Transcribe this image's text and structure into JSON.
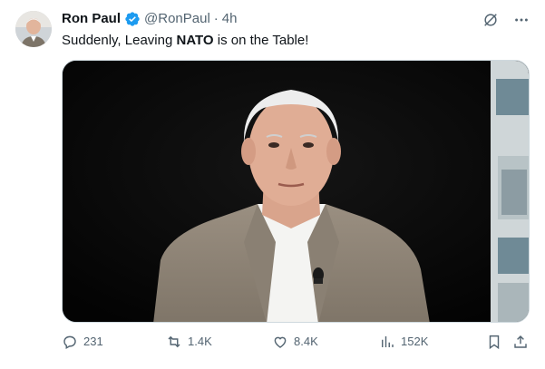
{
  "tweet": {
    "author_name": "Ron Paul",
    "handle": "@RonPaul",
    "separator": "·",
    "time": "4h",
    "text_prefix": "Suddenly, Leaving ",
    "text_bold": "NATO",
    "text_suffix": " is on the Table!"
  },
  "actions": {
    "replies": "231",
    "reposts": "1.4K",
    "likes": "8.4K",
    "views": "152K"
  },
  "colors": {
    "verified": "#1d9bf0",
    "muted_text": "#536471",
    "primary_text": "#0f1419"
  },
  "icons": [
    "grok-icon",
    "more-icon",
    "reply-icon",
    "repost-icon",
    "like-icon",
    "views-icon",
    "bookmark-icon",
    "share-icon",
    "verified-badge-icon"
  ]
}
